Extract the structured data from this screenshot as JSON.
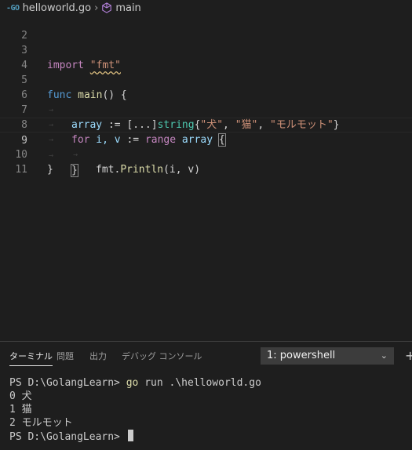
{
  "breadcrumb": {
    "file_icon_text": "-GO",
    "file_name": "helloworld.go",
    "symbol_name": "main"
  },
  "editor": {
    "line_numbers": [
      "2",
      "3",
      "4",
      "5",
      "6",
      "7",
      "8",
      "9",
      "10",
      "11"
    ],
    "line_import_kw": "import",
    "line_import_str": "\"fmt\"",
    "func_kw": "func",
    "func_name": "main",
    "func_rest": "() {",
    "arr_var": "array",
    "arr_op": " := [...]",
    "arr_type": "string",
    "arr_open": "{",
    "arr_s1": "\"犬\"",
    "arr_c1": ", ",
    "arr_s2": "\"猫\"",
    "arr_c2": ", ",
    "arr_s3": "\"モルモット\"",
    "arr_close": "}",
    "for_kw": "for",
    "for_vars": " i, v ",
    "for_op": ":= ",
    "range_kw": "range",
    "for_array": " array ",
    "for_brace": "{",
    "print_pkg": "fmt",
    "print_dot": ".",
    "print_fn": "Println",
    "print_args": "(i, v)",
    "close_inner": "}",
    "close_outer": "}"
  },
  "panel": {
    "tabs": [
      "ターミナル",
      "問題",
      "出力",
      "デバッグ コンソール"
    ],
    "terminal_select": "1: powershell",
    "terminal_lines": {
      "prompt1": "PS D:\\GolangLearn> ",
      "cmd": "go",
      "cmd_rest": " run .\\helloworld.go",
      "out1": "0 犬",
      "out2": "1 猫",
      "out3": "2 モルモット",
      "prompt2": "PS D:\\GolangLearn> "
    }
  }
}
